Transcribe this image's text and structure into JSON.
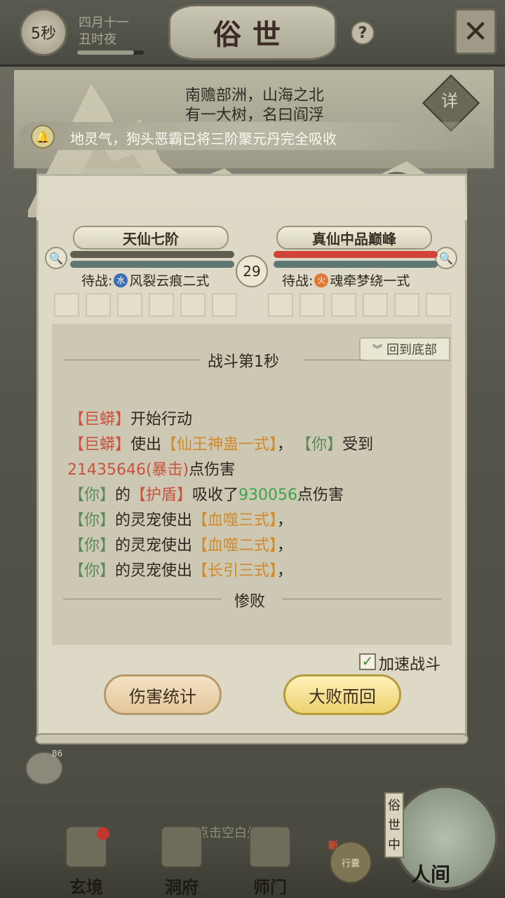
{
  "topbar": {
    "timer": "5秒",
    "date_line1": "四月十一",
    "date_line2": "丑时夜",
    "progress": 0.85,
    "title": "俗世",
    "help_icon": "?",
    "close_icon": "✕"
  },
  "location": {
    "line1": "南赡部洲，山海之北",
    "line2": "有一大树，名曰阎浮",
    "detail_label": "详"
  },
  "notice": {
    "icon": "bell-icon",
    "text": "地灵气，狗头恶霸已将三阶聚元丹完全吸收"
  },
  "battle": {
    "left": {
      "name": "天仙七阶",
      "hp": 1.0,
      "pending_label": "待战:",
      "element": "水",
      "element_color": "#3a6fb8",
      "skill": "风裂云痕二式"
    },
    "right": {
      "name": "真仙中品巅峰",
      "hp": 1.0,
      "pending_label": "待战:",
      "element": "火",
      "element_color": "#e0762f",
      "skill": "魂牵梦绕一式"
    },
    "round": "29"
  },
  "log": {
    "back_to_bottom": "回到底部",
    "section_title": "战斗第1秒",
    "lines": {
      "l1_a": "【巨蟒】",
      "l1_b": "开始行动",
      "l2_a": "【巨蟒】",
      "l2_b": "使出",
      "l2_c": "【仙王神蛊一式】",
      "l2_d": "，",
      "l2_e": "【你】",
      "l2_f": "受到",
      "l3_a": "21435646(暴击)",
      "l3_b": "点伤害",
      "l4_a": "【你】",
      "l4_b": "的",
      "l4_c": "【护盾】",
      "l4_d": "吸收了",
      "l4_e": "930056",
      "l4_f": "点伤害",
      "l5_a": "【你】",
      "l5_b": "的灵宠使出",
      "l5_c": "【血噬三式】",
      "l5_d": "，",
      "l6_a": "【你】",
      "l6_b": "的灵宠使出",
      "l6_c": "【血噬二式】",
      "l6_d": "，",
      "l7_a": "【你】",
      "l7_b": "的灵宠使出",
      "l7_c": "【长引三式】",
      "l7_d": "，"
    },
    "result": "惨败"
  },
  "controls": {
    "speed_label": "加速战斗",
    "speed_checked": true,
    "stats_button": "伤害统计",
    "retreat_button": "大败而回"
  },
  "bottom": {
    "chat_count": "86",
    "tap_hint": "点击空白处返回",
    "nav": {
      "xuanjing": "玄境",
      "dongfu": "洞府",
      "shimen": "师门",
      "bag_new": "新",
      "bag": "行囊",
      "renjian": "人间",
      "sushizhong": "俗世中"
    }
  }
}
